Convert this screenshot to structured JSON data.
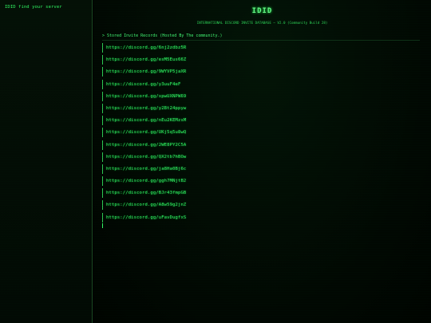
{
  "sidebar": {
    "link_label": "IDID find your server"
  },
  "header": {
    "title": "IDID",
    "subtitle": "INTERNATIONAL DISCORD INVITE DATABASE — V2.0 (Community Build 28)"
  },
  "section": {
    "header_label": "> Stored Invite Records (Hosted By The community.)"
  },
  "invites": [
    "https://discord.gg/6nj2zdbz5R",
    "https://discord.gg/esM5Eus66Z",
    "https://discord.gg/9WYVP5jaXR",
    "https://discord.gg/y3uuF4eF",
    "https://discord.gg/xpwUXNPW69",
    "https://discord.gg/y2Bt24ppyw",
    "https://discord.gg/nEu2KEMzsM",
    "https://discord.gg/UKj5q5u8wQ",
    "https://discord.gg/2WE8PY2C5A",
    "https://discord.gg/QX2tb7hBOw",
    "https://discord.gg/ja8Ha0Bj6c",
    "https://discord.gg/ggh7MNjtB2",
    "https://discord.gg/BJr43fmpGB",
    "https://discord.gg/A8w59g2jnZ",
    "https://discord.gg/uFavDugfxS"
  ],
  "colors": {
    "accent": "#33ff66",
    "background": "#000000",
    "border": "#2ecc55"
  }
}
